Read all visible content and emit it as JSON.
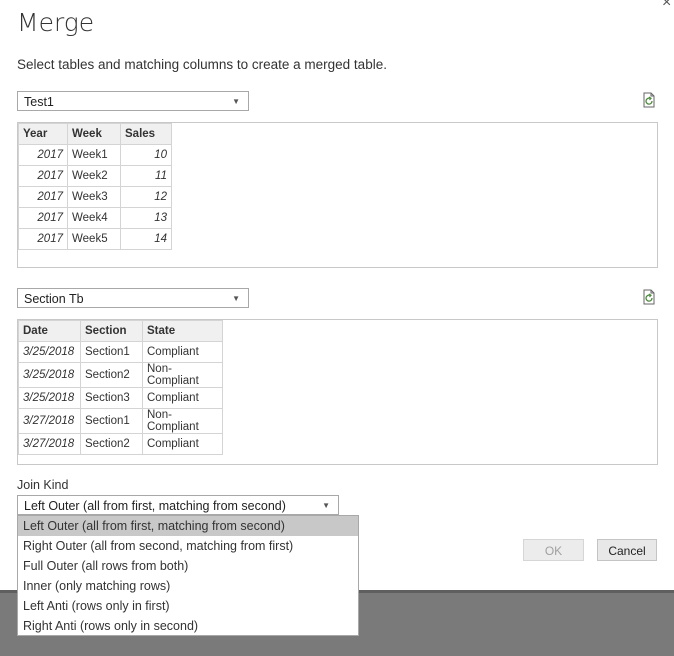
{
  "dialog": {
    "title": "Merge",
    "subtitle": "Select tables and matching columns to create a merged table.",
    "close_glyph": "×"
  },
  "table1": {
    "selected": "Test1",
    "columns": [
      "Year",
      "Week",
      "Sales"
    ],
    "rows": [
      [
        "2017",
        "Week1",
        "10"
      ],
      [
        "2017",
        "Week2",
        "11"
      ],
      [
        "2017",
        "Week3",
        "12"
      ],
      [
        "2017",
        "Week4",
        "13"
      ],
      [
        "2017",
        "Week5",
        "14"
      ]
    ]
  },
  "table2": {
    "selected": "Section Tb",
    "columns": [
      "Date",
      "Section",
      "State"
    ],
    "rows": [
      [
        "3/25/2018",
        "Section1",
        "Compliant"
      ],
      [
        "3/25/2018",
        "Section2",
        "Non-Compliant"
      ],
      [
        "3/25/2018",
        "Section3",
        "Compliant"
      ],
      [
        "3/27/2018",
        "Section1",
        "Non-Compliant"
      ],
      [
        "3/27/2018",
        "Section2",
        "Compliant"
      ]
    ]
  },
  "join": {
    "label": "Join Kind",
    "selected": "Left Outer (all from first, matching from second)",
    "options": [
      "Left Outer (all from first, matching from second)",
      "Right Outer (all from second, matching from first)",
      "Full Outer (all rows from both)",
      "Inner (only matching rows)",
      "Left Anti (rows only in first)",
      "Right Anti (rows only in second)"
    ]
  },
  "buttons": {
    "ok": "OK",
    "cancel": "Cancel"
  },
  "icons": {
    "dropdown_arrow": "▼",
    "refresh": "refresh-icon"
  },
  "colors": {
    "header_bg": "#f0f0f0",
    "selected_option": "#c8c8c8",
    "footer": "#7a7a7a"
  }
}
